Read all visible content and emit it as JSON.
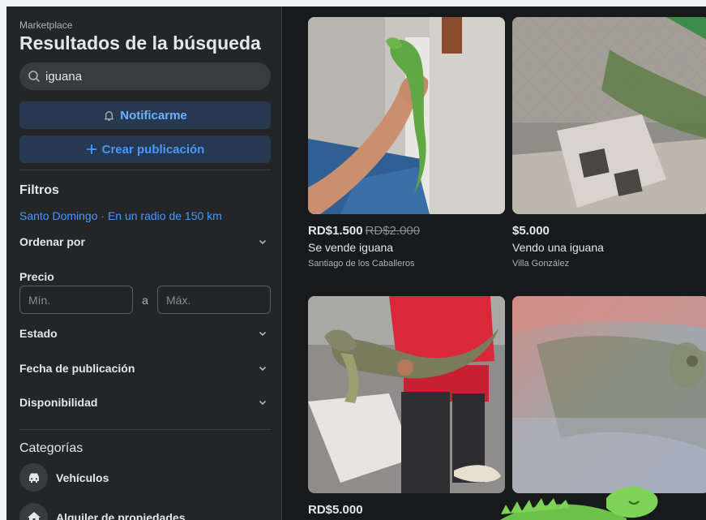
{
  "sidebar": {
    "breadcrumb": "Marketplace",
    "title": "Resultados de la búsqueda",
    "search_value": "iguana",
    "notify_label": "Notificarme",
    "create_label": "Crear publicación",
    "filters_heading": "Filtros",
    "location_text": "Santo Domingo · En un radio de 150 km",
    "sort_label": "Ordenar por",
    "price_label": "Precio",
    "price_min_placeholder": "Mín.",
    "price_separator": "a",
    "price_max_placeholder": "Máx.",
    "state_label": "Estado",
    "date_label": "Fecha de publicación",
    "availability_label": "Disponibilidad",
    "categories_heading": "Categorías",
    "categories": [
      {
        "label": "Vehículos",
        "icon": "car-icon"
      },
      {
        "label": "Alquiler de propiedades",
        "icon": "house-icon"
      }
    ]
  },
  "listings": [
    {
      "price": "RD$1.500",
      "old_price": "RD$2.000",
      "title": "Se vende iguana",
      "location": "Santiago de los Caballeros"
    },
    {
      "price": "$5.000",
      "old_price": "",
      "title": "Vendo una iguana",
      "location": "Villa González"
    },
    {
      "price": "RD$5.000",
      "old_price": "",
      "title": "",
      "location": ""
    },
    {
      "price": "",
      "old_price": "",
      "title": "",
      "location": ""
    }
  ],
  "colors": {
    "accent": "#2d88ff",
    "background": "#18191a",
    "sidebar": "#242526"
  }
}
